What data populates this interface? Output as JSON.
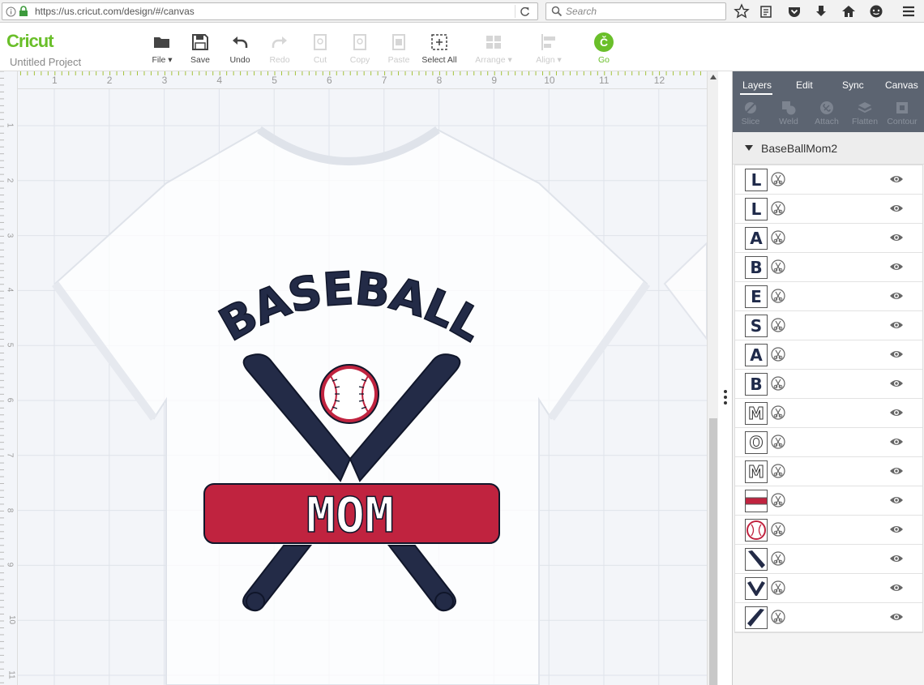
{
  "browser": {
    "url": "https://us.cricut.com/design/#/canvas",
    "search_placeholder": "Search"
  },
  "app": {
    "logo": "Cricut",
    "project_title": "Untitled Project"
  },
  "toolbar": {
    "file": "File",
    "save": "Save",
    "undo": "Undo",
    "redo": "Redo",
    "cut": "Cut",
    "copy": "Copy",
    "paste": "Paste",
    "select_all": "Select All",
    "arrange": "Arrange",
    "align": "Align",
    "go": "Go"
  },
  "ruler": {
    "top": [
      "1",
      "2",
      "3",
      "4",
      "5",
      "6",
      "7",
      "8",
      "9",
      "10",
      "11",
      "12"
    ],
    "left": [
      "1",
      "2",
      "3",
      "4",
      "5",
      "6",
      "7",
      "8",
      "9",
      "10",
      "11"
    ]
  },
  "design": {
    "arc_text": "BASEBALL",
    "banner_text": "MOM",
    "colors": {
      "navy": "#232b47",
      "red": "#c0233f",
      "white": "#ffffff"
    }
  },
  "panel": {
    "tabs": [
      "Layers",
      "Edit",
      "Sync",
      "Canvas"
    ],
    "actions": [
      "Slice",
      "Weld",
      "Attach",
      "Flatten",
      "Contour"
    ],
    "group_name": "BaseBallMom2",
    "layers": [
      {
        "thumb": "L",
        "style": "solid"
      },
      {
        "thumb": "L",
        "style": "solid"
      },
      {
        "thumb": "A",
        "style": "solid"
      },
      {
        "thumb": "B",
        "style": "solid"
      },
      {
        "thumb": "E",
        "style": "solid"
      },
      {
        "thumb": "S",
        "style": "solid"
      },
      {
        "thumb": "A",
        "style": "solid"
      },
      {
        "thumb": "B",
        "style": "solid"
      },
      {
        "thumb": "M",
        "style": "outline"
      },
      {
        "thumb": "O",
        "style": "outline"
      },
      {
        "thumb": "M",
        "style": "outline"
      },
      {
        "thumb": "",
        "style": "banner"
      },
      {
        "thumb": "",
        "style": "ball"
      },
      {
        "thumb": "",
        "style": "bat-right"
      },
      {
        "thumb": "",
        "style": "bats-v"
      },
      {
        "thumb": "",
        "style": "bat-left"
      }
    ]
  }
}
